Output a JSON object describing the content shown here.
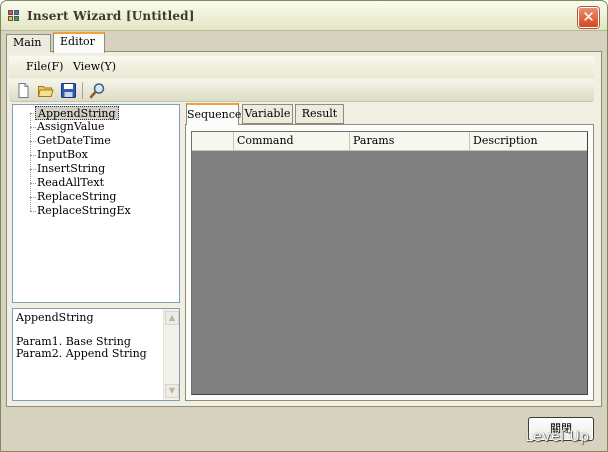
{
  "window": {
    "title": "Insert Wizard [Untitled]"
  },
  "outer_tabs": {
    "main": "Main",
    "editor": "Editor"
  },
  "menu": {
    "file": "File(F)",
    "view": "View(Y)"
  },
  "toolbar": {
    "icons": [
      "new-file-icon",
      "open-folder-icon",
      "save-disk-icon",
      "find-magnifier-icon"
    ]
  },
  "tree": {
    "items": [
      "AppendString",
      "AssignValue",
      "GetDateTime",
      "InputBox",
      "InsertString",
      "ReadAllText",
      "ReplaceString",
      "ReplaceStringEx"
    ],
    "selected": "AppendString"
  },
  "description": {
    "text": "AppendString\n\nParam1. Base String\nParam2. Append String"
  },
  "inner_tabs": {
    "sequence": "Sequence",
    "variable": "Variable",
    "result": "Result"
  },
  "grid": {
    "columns": [
      "",
      "Command",
      "Params",
      "Description"
    ],
    "rows": []
  },
  "buttons": {
    "close": "關閉"
  },
  "watermark": "Level Up",
  "colors": {
    "active_tab_accent": "#f0a040",
    "grid_background": "#808080",
    "close_button": "#d5471f"
  }
}
